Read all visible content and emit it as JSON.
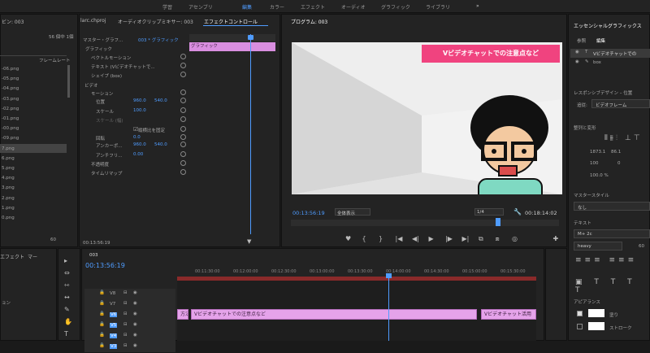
{
  "workspaces": [
    "学習",
    "アセンブリ",
    "編集",
    "カラー",
    "エフェクト",
    "オーディオ",
    "グラフィック",
    "ライブラリ"
  ],
  "left": {
    "title": "ビン: 003",
    "count": "56 個中 1個",
    "col": "フレームレート",
    "files": [
      "-06.png",
      "-05.png",
      "-04.png",
      "-03.png",
      "-02.png",
      "-01.png",
      "-00.png",
      "-09.png",
      "7.png",
      "6.png",
      "5.png",
      "4.png",
      "3.png",
      "2.png",
      "1.png",
      "0.png"
    ]
  },
  "effects": {
    "tabs": [
      "larc.chproj",
      "オーディオクリップミキサー: 003",
      "エフェクトコントロール"
    ],
    "master": "マスター・グラフ...",
    "seq": "003 * グラフィック",
    "graphic_label": "グラフィック",
    "clip_label": "グラフィック",
    "rows": [
      "ベクトルモーション",
      "テキスト (Vビデオチャットで...",
      "シェイプ (box)",
      "ビデオ",
      "モーション",
      "位置",
      "スケール",
      "スケール (幅)",
      "縦横比を固定",
      "回転",
      "アンカーポ...",
      "アンチフリ...",
      "不透明度",
      "タイムリマップ"
    ],
    "vals": {
      "pos_x": "960.0",
      "pos_y": "540.0",
      "scale": "100.0",
      "scale_w": "100.0",
      "rot": "0.0",
      "anc_x": "960.0",
      "anc_y": "540.0",
      "anti": "0.00"
    },
    "time": "00:13:56:19"
  },
  "program": {
    "title": "プログラム: 003",
    "banner": "Vビデオチャットでの注意点など",
    "timecode": "00:13:56:19",
    "fit": "全体表示",
    "quality": "1/4",
    "duration": "00:18:14:02"
  },
  "eg": {
    "title": "エッセンシャルグラフィックス",
    "tabs": [
      "参照",
      "編集"
    ],
    "layers": [
      "Vビデオチャットでの",
      "box"
    ],
    "responsive": "レスポンシブデザイン – 位置",
    "pin_label": "追従:",
    "pin_value": "ビデオフレーム",
    "align": "整列と変形",
    "pos_x": "1873.1",
    "pos_y": "86.1",
    "scale_pct": "100",
    "rot": "0",
    "opacity": "100.0 %",
    "master_style": "マスタースタイル",
    "none": "なし",
    "text": "テキスト",
    "font": "M+ 2c",
    "weight": "heavy",
    "size": "60",
    "appearance": "アピアランス",
    "fill": "塗り",
    "stroke": "ストローク"
  },
  "project2": {
    "tab": "エフェクト",
    "tab2": "マー",
    "item": "ョン",
    "zoom": "60"
  },
  "timeline": {
    "seq": "003",
    "timecode": "00:13:56:19",
    "ticks": [
      "00:11:30:00",
      "00:12:00:00",
      "00:12:30:00",
      "00:13:00:00",
      "00:13:30:00",
      "00:14:00:00",
      "00:14:30:00",
      "00:15:00:00",
      "00:15:30:00"
    ],
    "tracks": [
      "V8",
      "V7",
      "V6",
      "V5",
      "V4",
      "V3"
    ],
    "clip_a": "方法",
    "clip_b": "Vビデオチャットでの注意点など",
    "clip_c": "Vビデオチャット活用"
  },
  "colors": {
    "accent": "#4f9cff",
    "clip": "#e5a3ea",
    "banner": "#f0437f"
  }
}
